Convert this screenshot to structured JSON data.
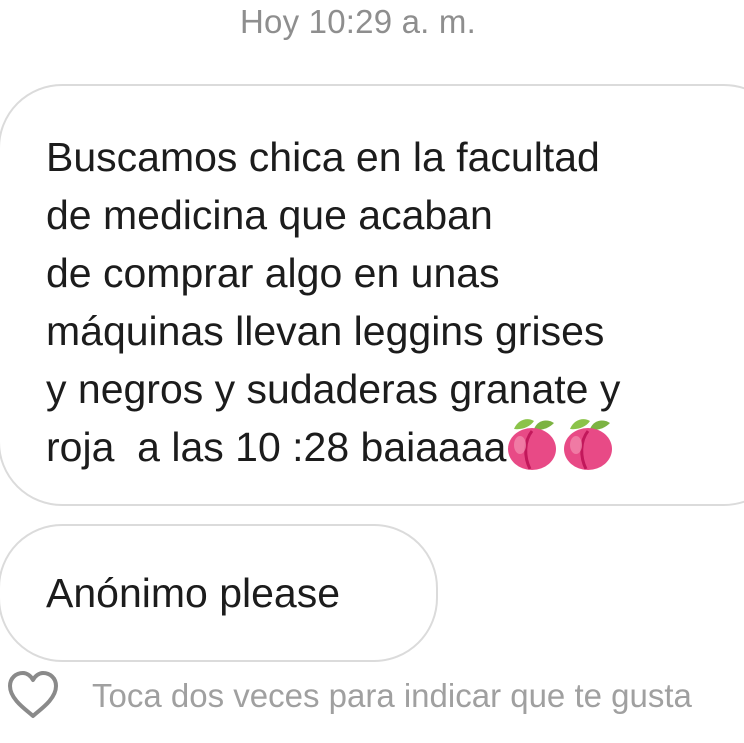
{
  "conversation": {
    "timestamp": "Hoy 10:29 a. m.",
    "messages": [
      {
        "lines": [
          "Buscamos chica en la facultad",
          "de medicina que acaban",
          "de comprar algo en unas",
          "máquinas llevan leggins grises",
          "y negros y sudaderas granate y",
          "roja  a las 10 :28 baiaaaa"
        ],
        "trailing_emoji": [
          "peach-emoji",
          "peach-emoji"
        ]
      },
      {
        "text": "Anónimo please"
      }
    ],
    "like_hint": "Toca dos veces para indicar que te gusta"
  },
  "colors": {
    "background": "#ffffff",
    "bubble_border": "#dbdbdb",
    "message_text": "#1c1c1c",
    "muted_text": "#8e8e8e",
    "peach": "#e84a86",
    "leaf": "#8bc34a"
  },
  "icons": {
    "like": "heart-outline-icon",
    "emoji": "peach-emoji"
  }
}
